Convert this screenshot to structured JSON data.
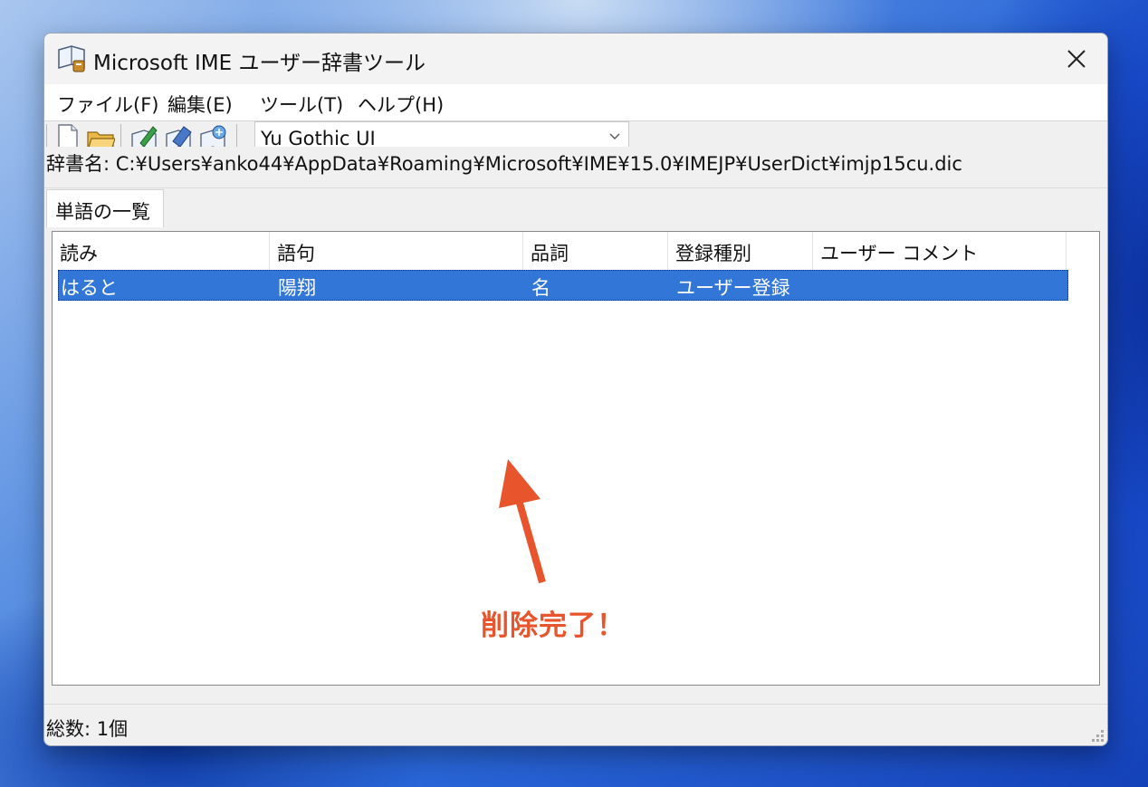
{
  "window": {
    "title": "Microsoft IME ユーザー辞書ツール"
  },
  "menu": {
    "file": "ファイル(F)",
    "edit": "編集(E)",
    "tools": "ツール(T)",
    "help": "ヘルプ(H)"
  },
  "toolbar": {
    "icons": [
      "new-document-icon",
      "open-folder-icon",
      "edit-word-icon",
      "delete-word-icon",
      "register-word-icon"
    ],
    "font_value": "Yu Gothic UI"
  },
  "dictionary": {
    "path_label": "辞書名: C:¥Users¥anko44¥AppData¥Roaming¥Microsoft¥IME¥15.0¥IMEJP¥UserDict¥imjp15cu.dic"
  },
  "tab": {
    "label": "単語の一覧"
  },
  "table": {
    "columns": [
      "読み",
      "語句",
      "品詞",
      "登録種別",
      "ユーザー コメント"
    ],
    "rows": [
      [
        "はると",
        "陽翔",
        "名",
        "ユーザー登録",
        ""
      ]
    ],
    "selected_row": 0
  },
  "annotation": {
    "text": "削除完了！",
    "color": "#e8542b"
  },
  "status": {
    "total": "総数: 1個"
  },
  "colors": {
    "selection": "#3277d7",
    "window_bg": "#f0f0f0"
  }
}
